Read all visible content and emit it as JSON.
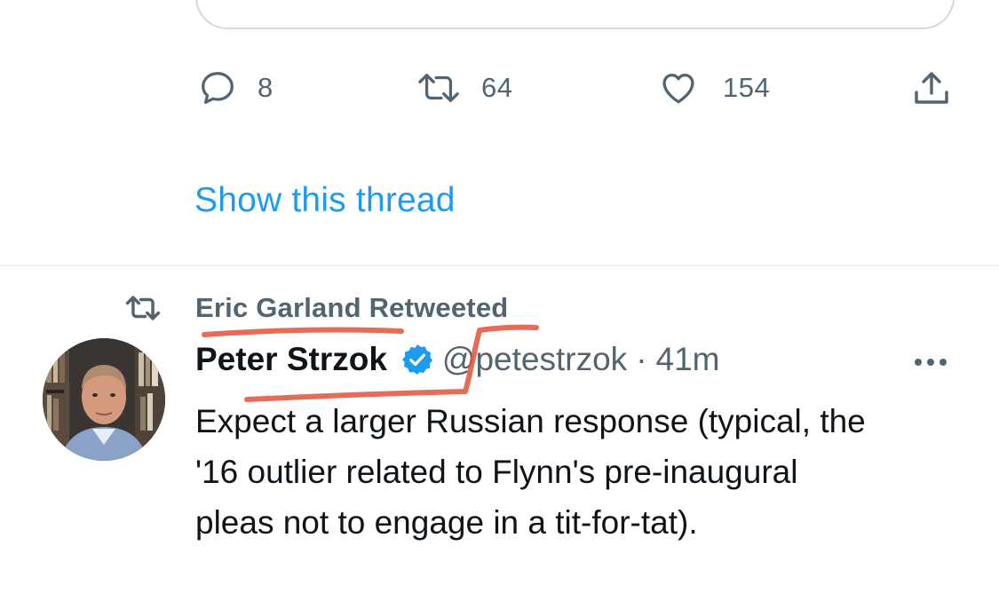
{
  "previous_tweet": {
    "actions": {
      "reply_count": "8",
      "retweet_count": "64",
      "like_count": "154"
    },
    "show_thread_label": "Show this thread"
  },
  "tweet": {
    "retweeted_by": "Eric Garland Retweeted",
    "author_name": "Peter Strzok",
    "author_handle": "@petestrzok",
    "separator": "·",
    "time": "41m",
    "text_lines": [
      "Expect a larger Russian response (typical, the",
      "'16 outlier related to Flynn's pre-inaugural",
      "pleas not to engage in a tit-for-tat)."
    ]
  },
  "colors": {
    "link": "#1d9bf0",
    "secondary_text": "#536471",
    "primary_text": "#0f1419",
    "verified": "#1d9bf0",
    "annotation": "#e0533a"
  },
  "icons": [
    "reply-icon",
    "retweet-icon",
    "like-icon",
    "share-icon",
    "verified-badge-icon",
    "more-options-icon"
  ]
}
